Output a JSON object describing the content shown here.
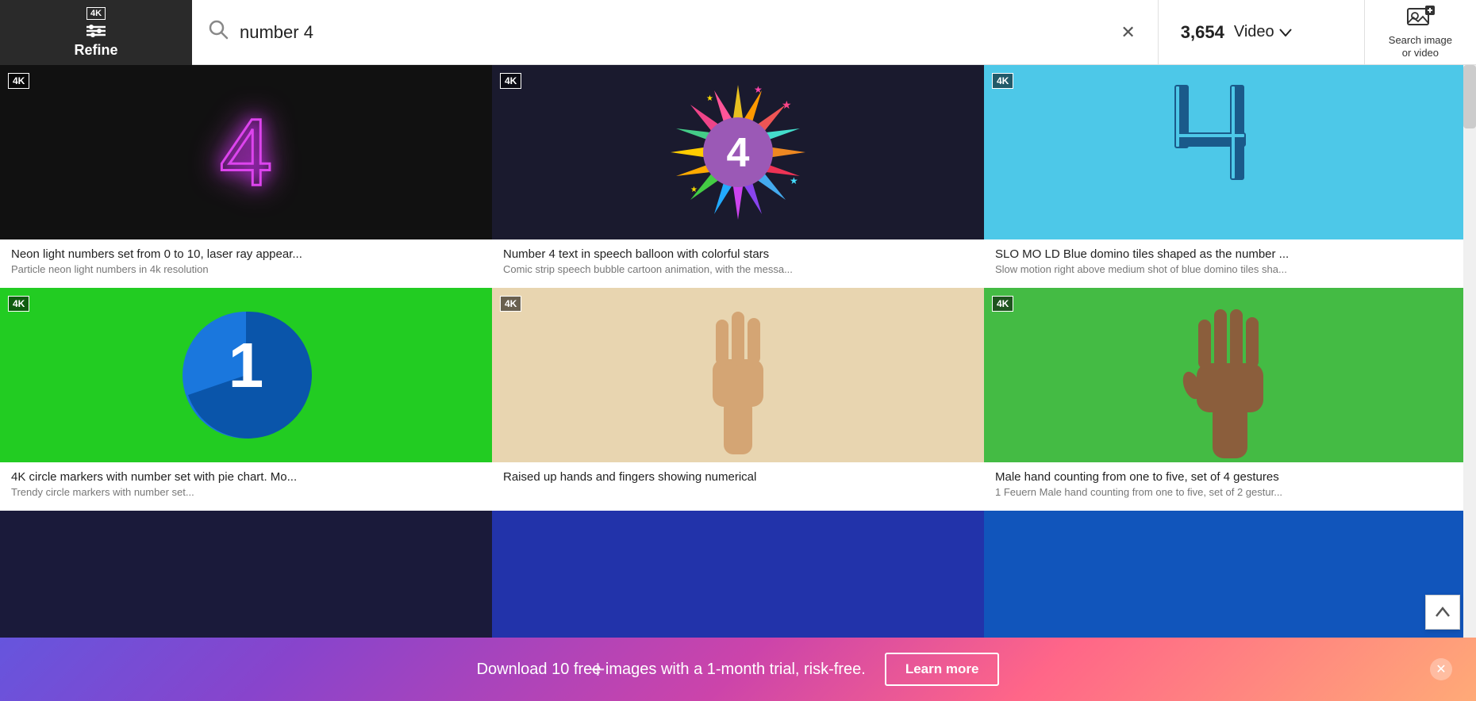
{
  "header": {
    "refine_label": "Refine",
    "refine_badge": "4K",
    "search_query": "number 4",
    "results_count": "3,654",
    "video_label": "Video",
    "search_image_label": "Search image\nor video"
  },
  "grid": {
    "items": [
      {
        "id": 1,
        "badge": "4K",
        "title": "Neon light numbers set from 0 to 10, laser ray appear...",
        "subtitle": "Particle neon light numbers in 4k resolution",
        "bg": "neon"
      },
      {
        "id": 2,
        "badge": "4K",
        "title": "Number 4 text in speech balloon with colorful stars",
        "subtitle": "Comic strip speech bubble cartoon animation, with the messa...",
        "bg": "starburst"
      },
      {
        "id": 3,
        "badge": "4K",
        "title": "SLO MO LD Blue domino tiles shaped as the number ...",
        "subtitle": "Slow motion right above medium shot of blue domino tiles sha...",
        "bg": "domino"
      },
      {
        "id": 4,
        "badge": "4K",
        "title": "4K circle markers with number set with pie chart. Mo...",
        "subtitle": "Trendy circle markers with number set...",
        "bg": "circle"
      },
      {
        "id": 5,
        "badge": "4K",
        "title": "Raised up hands and fingers showing numerical",
        "subtitle": "",
        "bg": "hand-beige"
      },
      {
        "id": 6,
        "badge": "4K",
        "title": "Male hand counting from one to five, set of 4 gestures",
        "subtitle": "1 Feuern Male hand counting from one to five, set of 2 gestur...",
        "bg": "hand-green"
      }
    ],
    "bottom_items": [
      {
        "id": 7,
        "bg": "dark-blue"
      },
      {
        "id": 8,
        "bg": "dark-blue"
      },
      {
        "id": 9,
        "bg": "dark-blue"
      }
    ]
  },
  "banner": {
    "text": "Download 10 free images with a 1-month trial, risk-free.",
    "learn_more": "Learn more",
    "plus_icon": "+"
  }
}
